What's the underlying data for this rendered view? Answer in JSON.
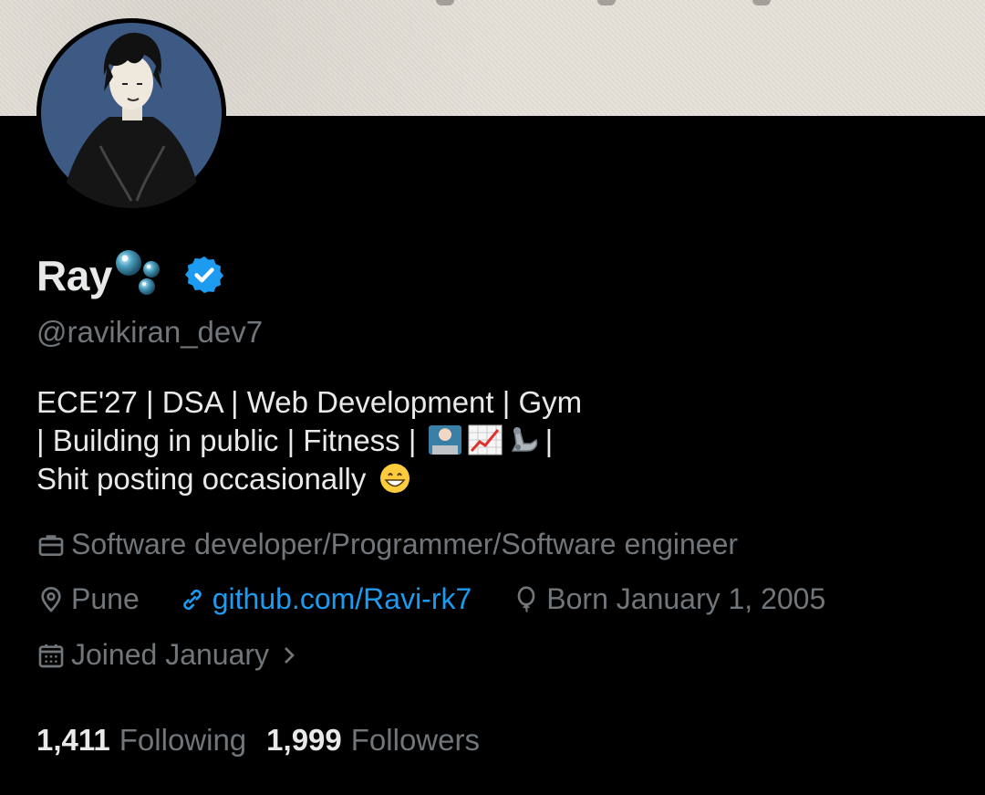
{
  "profile": {
    "display_name": "Ray",
    "name_emoji": "bubbles",
    "verified": true,
    "handle": "@ravikiran_dev7",
    "bio": {
      "line1": "ECE'27 | DSA | Web Development | Gym",
      "line2_prefix": "| Building in public | Fitness |",
      "line2_emojis": [
        "technologist-emoji",
        "chart-increasing-emoji",
        "mechanical-arm-emoji"
      ],
      "line2_suffix": "|",
      "line3_text": "Shit posting occasionally",
      "line3_emoji": "grinning-face-emoji"
    },
    "category": "Software developer/Programmer/Software engineer",
    "location": "Pune",
    "website": "github.com/Ravi-rk7",
    "birthday": "Born January 1, 2005",
    "joined": "Joined January",
    "following_count": "1,411",
    "following_label": "Following",
    "followers_count": "1,999",
    "followers_label": "Followers"
  },
  "colors": {
    "background": "#000000",
    "text_primary": "#e7e9ea",
    "text_secondary": "#71767b",
    "accent": "#1d9bf0"
  },
  "icons": {
    "category": "briefcase-icon",
    "location": "location-pin-icon",
    "website": "link-icon",
    "birthday": "balloon-icon",
    "joined": "calendar-icon",
    "joined_more": "chevron-right-icon"
  }
}
